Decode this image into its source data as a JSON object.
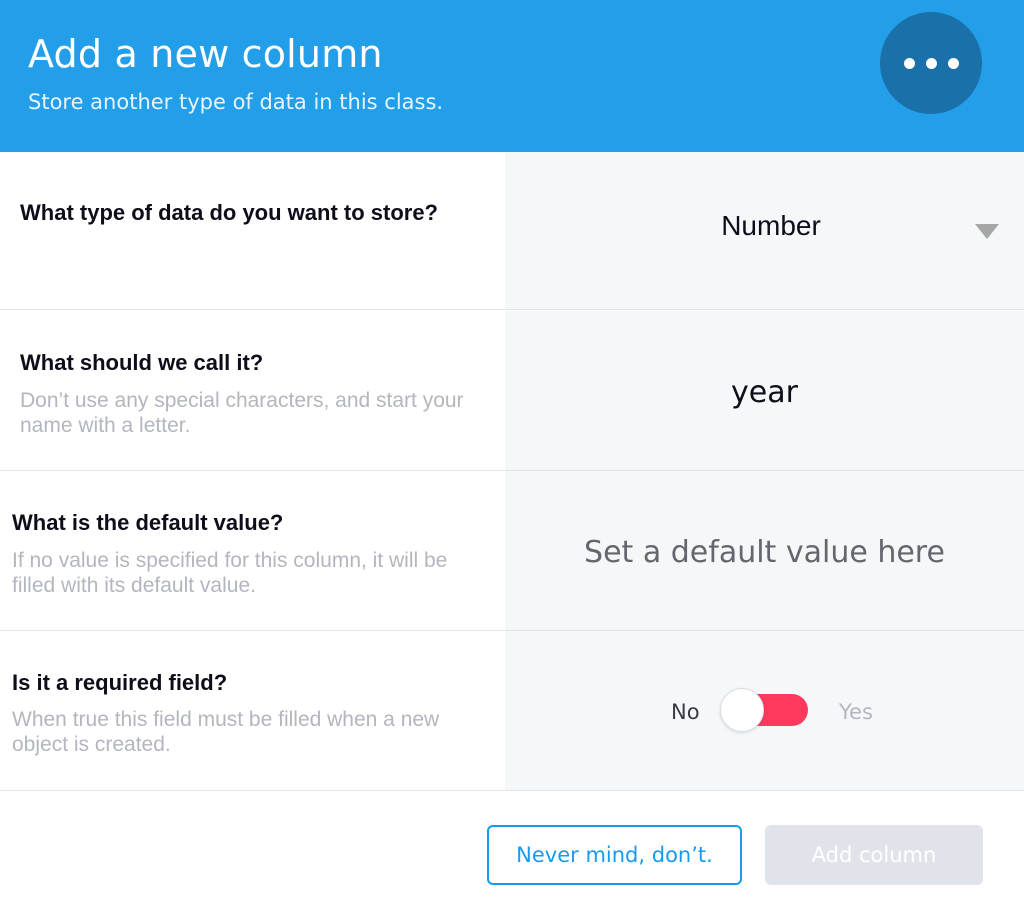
{
  "header": {
    "title": "Add a new column",
    "subtitle": "Store another type of data in this class.",
    "menu_icon": "more-horizontal-icon"
  },
  "type_field": {
    "question": "What type of data do you want to store?",
    "selected": "Number",
    "caret_icon": "caret-down-icon"
  },
  "name_field": {
    "question": "What should we call it?",
    "description": "Don’t use any special characters, and start your name with a letter.",
    "value": "year"
  },
  "default_field": {
    "question": "What is the default value?",
    "description": "If no value is specified for this column, it will be filled with its default value.",
    "placeholder": "Set a default value here",
    "value": ""
  },
  "required_field": {
    "question": "Is it a required field?",
    "description": "When true this field must be filled when a new object is created.",
    "no_label": "No",
    "yes_label": "Yes",
    "toggle_value": false
  },
  "footer": {
    "cancel_label": "Never mind, don’t.",
    "submit_label": "Add column"
  },
  "colors": {
    "header_bg": "#239fe9",
    "menu_button_bg": "#1a70a8",
    "toggle_track": "#ff395e",
    "cancel_border": "#169cee",
    "submit_disabled_bg": "#e1e3eb"
  }
}
